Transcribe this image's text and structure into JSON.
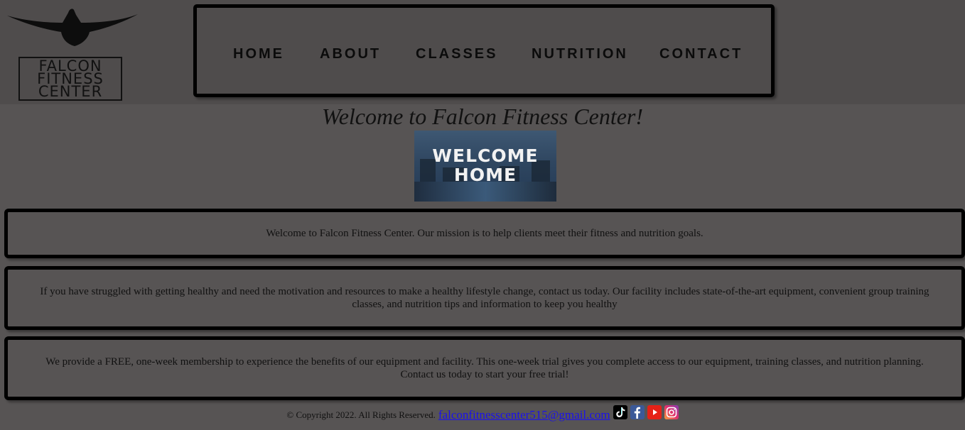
{
  "logo": {
    "line1": "FALCON",
    "line2": "FITNESS",
    "line3": "CENTER",
    "icon": "falcon-bird-icon"
  },
  "nav": {
    "items": [
      {
        "label": "HOME"
      },
      {
        "label": "ABOUT"
      },
      {
        "label": "CLASSES"
      },
      {
        "label": "NUTRITION"
      },
      {
        "label": "CONTACT"
      }
    ]
  },
  "welcome": {
    "title": "Welcome to Falcon Fitness Center!",
    "image_text_line1": "WELCOME",
    "image_text_line2": "HOME"
  },
  "sections": [
    {
      "text": "Welcome to Falcon Fitness Center. Our mission is to help clients meet their fitness and nutrition goals."
    },
    {
      "text": "If you have struggled with getting healthy and need the motivation and resources to make a healthy lifestyle change, contact us today. Our facility includes state-of-the-art equipment, convenient group training classes, and nutrition tips and information to keep you healthy"
    },
    {
      "text": "We provide a FREE, one-week membership to experience the benefits of our equipment and facility. This one-week trial gives you complete access to our equipment, training classes, and nutrition planning. Contact us today to start your free trial!"
    }
  ],
  "footer": {
    "copyright": "© Copyright 2022. All Rights Reserved.",
    "email": "falconfitnesscenter515@gmail.com",
    "social_icons": [
      "tiktok-icon",
      "facebook-icon",
      "youtube-icon",
      "instagram-icon"
    ]
  },
  "colors": {
    "background": "#575454",
    "header_background": "#4f4c4c",
    "border": "#000000",
    "link": "#1a10ee"
  }
}
